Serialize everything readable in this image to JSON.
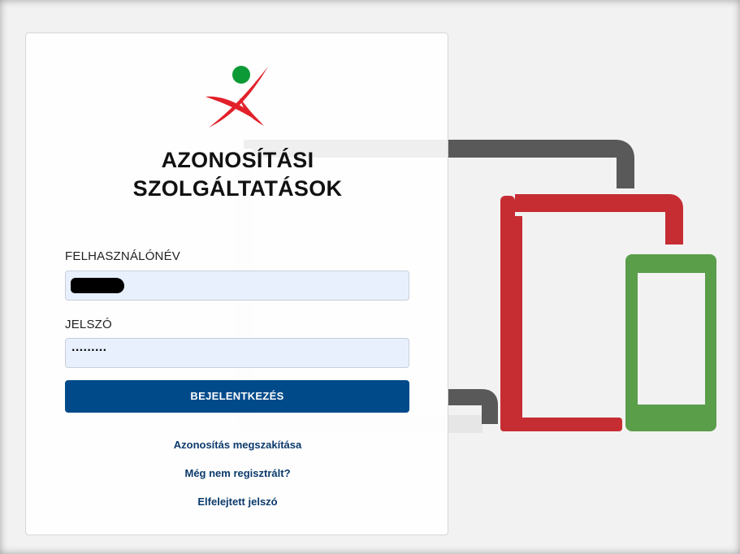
{
  "branding": {
    "title_line1": "AZONOSÍTÁSI",
    "title_line2": "SZOLGÁLTATÁSOK",
    "logo_icon": "figure-logo-icon",
    "colors": {
      "logo_red": "#e2202a",
      "logo_green": "#0c9a36",
      "button_blue": "#004a8a",
      "device_red": "#c62d33",
      "device_green": "#5a9e4a",
      "device_gray": "#595959"
    }
  },
  "form": {
    "username_label": "FELHASZNÁLÓNÉV",
    "password_label": "JELSZÓ",
    "password_value": "·········",
    "login_button": "BEJELENTKEZÉS"
  },
  "links": {
    "cancel": "Azonosítás megszakítása",
    "register": "Még nem regisztrált?",
    "forgot": "Elfelejtett jelszó"
  }
}
